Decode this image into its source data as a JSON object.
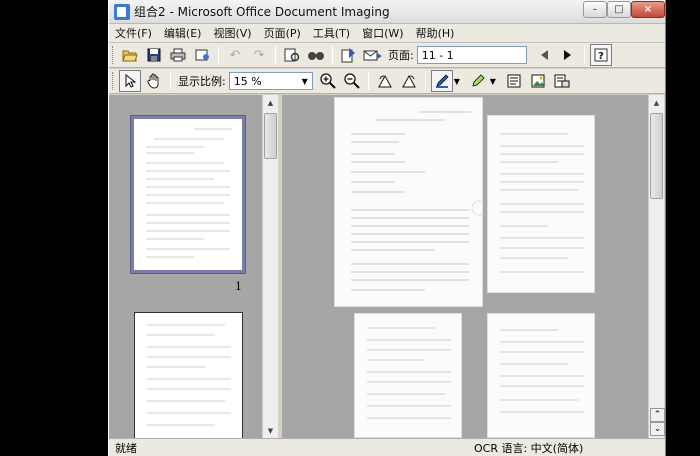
{
  "window": {
    "title": "组合2 - Microsoft Office Document Imaging",
    "controls": {
      "minimize": "–",
      "maximize": "□",
      "close": "×"
    }
  },
  "menu": {
    "items": [
      {
        "label": "文件(F)"
      },
      {
        "label": "编辑(E)"
      },
      {
        "label": "视图(V)"
      },
      {
        "label": "页面(P)"
      },
      {
        "label": "工具(T)"
      },
      {
        "label": "窗口(W)"
      },
      {
        "label": "帮助(H)"
      }
    ]
  },
  "toolbar1": {
    "icons": [
      "open-icon",
      "save-icon",
      "print-icon",
      "send-icon",
      "undo-icon",
      "redo-icon",
      "ocr-icon",
      "find-icon",
      "send-to-word-icon",
      "send-email-icon",
      "prev-page-icon",
      "next-page-icon",
      "help-icon"
    ],
    "page_label": "页面:",
    "page_value": "11 - 1"
  },
  "toolbar2": {
    "zoom_label": "显示比例:",
    "zoom_value": "15 %",
    "icons": [
      "select-icon",
      "hand-icon",
      "zoom-in-icon",
      "zoom-out-icon",
      "rotate-left-icon",
      "rotate-right-icon",
      "pen-icon",
      "highlighter-icon",
      "text-box-icon",
      "picture-icon",
      "annotations-icon"
    ]
  },
  "thumbnails": {
    "page_number": "1"
  },
  "status": {
    "left": "就绪",
    "right": "OCR 语言: 中文(简体)"
  },
  "colors": {
    "workspace": "#a6a6a6",
    "selected_thumb_border": "#7b7ea8",
    "chrome": "#ece9e0"
  }
}
